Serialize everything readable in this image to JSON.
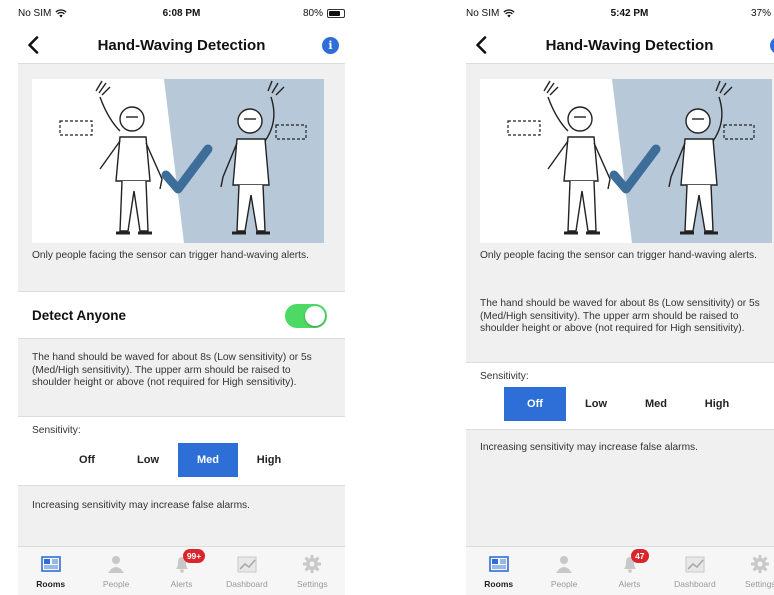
{
  "colors": {
    "accent_blue": "#2d6fd6",
    "toggle_green": "#4cd964",
    "badge_red": "#d9262c",
    "battery_black": "#111111",
    "battery_green": "#4cd964",
    "panel_blue": "#b7c8d9"
  },
  "screens": [
    {
      "status": {
        "carrier": "No SIM",
        "time": "6:08 PM",
        "battery": "80%",
        "battery_level": 0.8
      },
      "nav": {
        "title": "Hand-Waving Detection",
        "back_icon": "chevron-left-icon",
        "info_icon": "i"
      },
      "intro_text": "Only people facing the sensor can trigger hand-waving alerts.",
      "detect": {
        "label": "Detect Anyone",
        "enabled": true
      },
      "hand_text": "The hand should be waved for about 8s (Low sensitivity) or 5s (Med/High sensitivity). The upper arm should be raised to shoulder height or above (not required for High sensitivity).",
      "sensitivity": {
        "label": "Sensitivity:",
        "options": [
          "Off",
          "Low",
          "Med",
          "High"
        ],
        "selected": "Med"
      },
      "warning": "Increasing sensitivity may increase false alarms.",
      "tabs": [
        {
          "label": "Rooms",
          "icon": "rooms-icon",
          "active": true,
          "badge": ""
        },
        {
          "label": "People",
          "icon": "person-icon",
          "active": false,
          "badge": ""
        },
        {
          "label": "Alerts",
          "icon": "bell-icon",
          "active": false,
          "badge": "99+"
        },
        {
          "label": "Dashboard",
          "icon": "chart-icon",
          "active": false,
          "badge": ""
        },
        {
          "label": "Settings",
          "icon": "gear-icon",
          "active": false,
          "badge": ""
        }
      ]
    },
    {
      "status": {
        "carrier": "No SIM",
        "time": "5:42 PM",
        "battery": "37%",
        "battery_level": 0.37
      },
      "nav": {
        "title": "Hand-Waving Detection",
        "back_icon": "chevron-left-icon",
        "info_icon": "i"
      },
      "intro_text": "Only people facing the sensor can trigger hand-waving alerts.",
      "hand_text": "The hand should be waved for about 8s (Low sensitivity) or 5s (Med/High sensitivity). The upper arm should be raised to shoulder height or above (not required for High sensitivity).",
      "sensitivity": {
        "label": "Sensitivity:",
        "options": [
          "Off",
          "Low",
          "Med",
          "High"
        ],
        "selected": "Off"
      },
      "warning": "Increasing sensitivity may increase false alarms.",
      "tabs": [
        {
          "label": "Rooms",
          "icon": "rooms-icon",
          "active": true,
          "badge": ""
        },
        {
          "label": "People",
          "icon": "person-icon",
          "active": false,
          "badge": ""
        },
        {
          "label": "Alerts",
          "icon": "bell-icon",
          "active": false,
          "badge": "47"
        },
        {
          "label": "Dashboard",
          "icon": "chart-icon",
          "active": false,
          "badge": ""
        },
        {
          "label": "Settings",
          "icon": "gear-icon",
          "active": false,
          "badge": ""
        }
      ]
    }
  ]
}
